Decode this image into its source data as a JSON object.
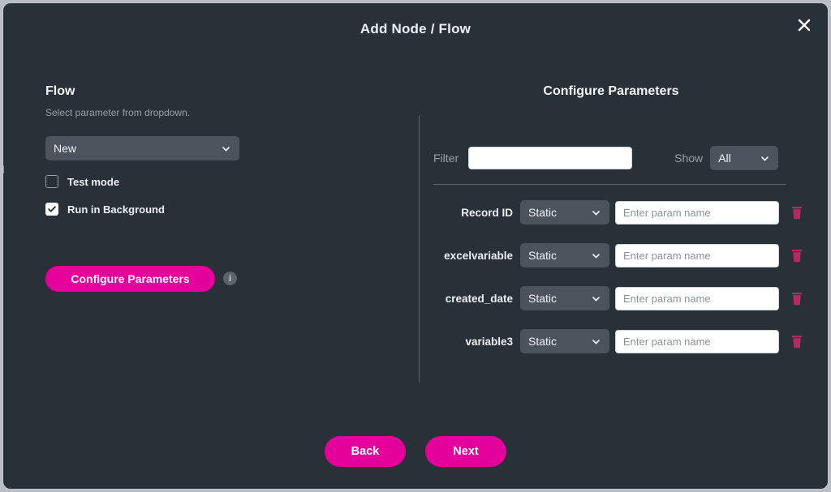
{
  "dialog": {
    "title": "Add Node / Flow",
    "close_icon": "close-icon"
  },
  "left": {
    "heading": "Flow",
    "subtitle": "Select parameter from dropdown.",
    "flow_select": {
      "value": "New",
      "chevron_icon": "chevron-down-icon"
    },
    "checkboxes": [
      {
        "label": "Test mode",
        "checked": false
      },
      {
        "label": "Run in Background",
        "checked": true
      }
    ],
    "configure_button": "Configure Parameters",
    "info_icon_label": "i"
  },
  "right": {
    "heading": "Configure Parameters",
    "filter": {
      "label": "Filter",
      "value": "",
      "placeholder": ""
    },
    "show": {
      "label": "Show",
      "value": "All"
    },
    "params": [
      {
        "name": "Record ID",
        "mode": "Static",
        "value": "",
        "placeholder": "Enter param name",
        "delete_icon": "trash-icon"
      },
      {
        "name": "excelvariable",
        "mode": "Static",
        "value": "",
        "placeholder": "Enter param name",
        "delete_icon": "trash-icon"
      },
      {
        "name": "created_date",
        "mode": "Static",
        "value": "",
        "placeholder": "Enter param name",
        "delete_icon": "trash-icon"
      },
      {
        "name": "variable3",
        "mode": "Static",
        "value": "",
        "placeholder": "Enter param name",
        "delete_icon": "trash-icon"
      }
    ]
  },
  "footer": {
    "back_label": "Back",
    "next_label": "Next"
  },
  "colors": {
    "background": "#283038",
    "accent": "#e6009b",
    "control": "#4b545d",
    "muted_text": "#9aa3ac",
    "divider": "#5c656e",
    "trash": "#b52a63"
  }
}
